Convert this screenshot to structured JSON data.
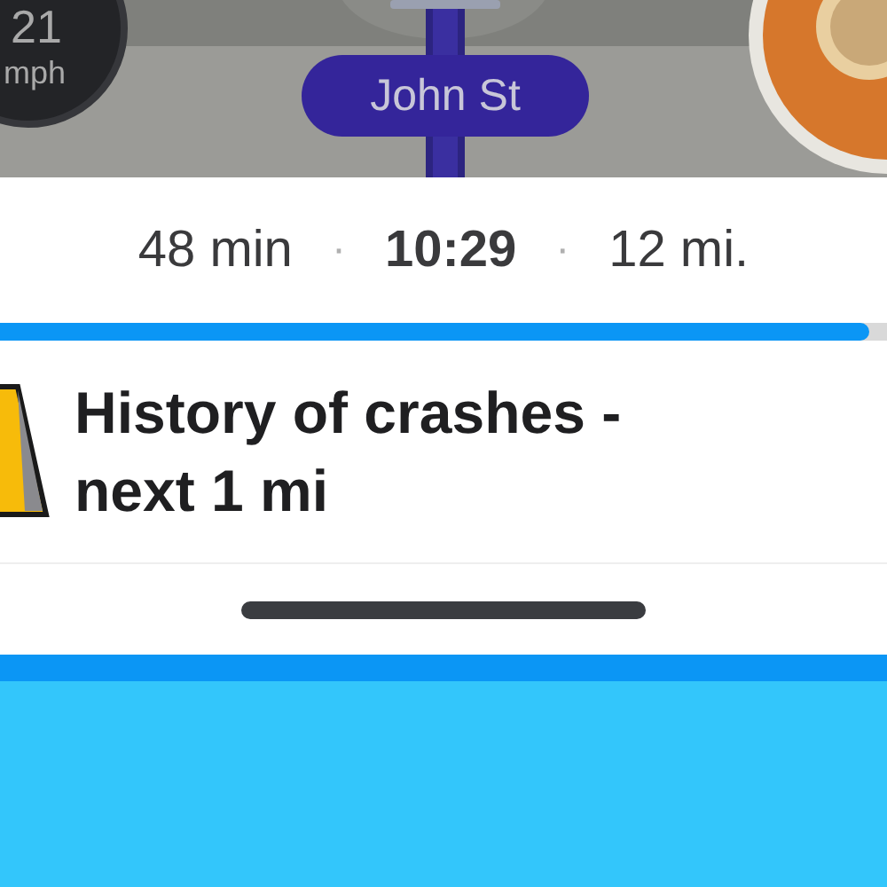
{
  "map": {
    "speed": {
      "value": "21",
      "unit": "mph"
    },
    "street": "John St"
  },
  "trip": {
    "duration": "48 min",
    "separator_1": "·",
    "arrival": "10:29",
    "separator_2": "·",
    "distance": "12 mi."
  },
  "progress": {
    "level": 0.98
  },
  "alert": {
    "text": "History of crashes - next 1 mi"
  }
}
